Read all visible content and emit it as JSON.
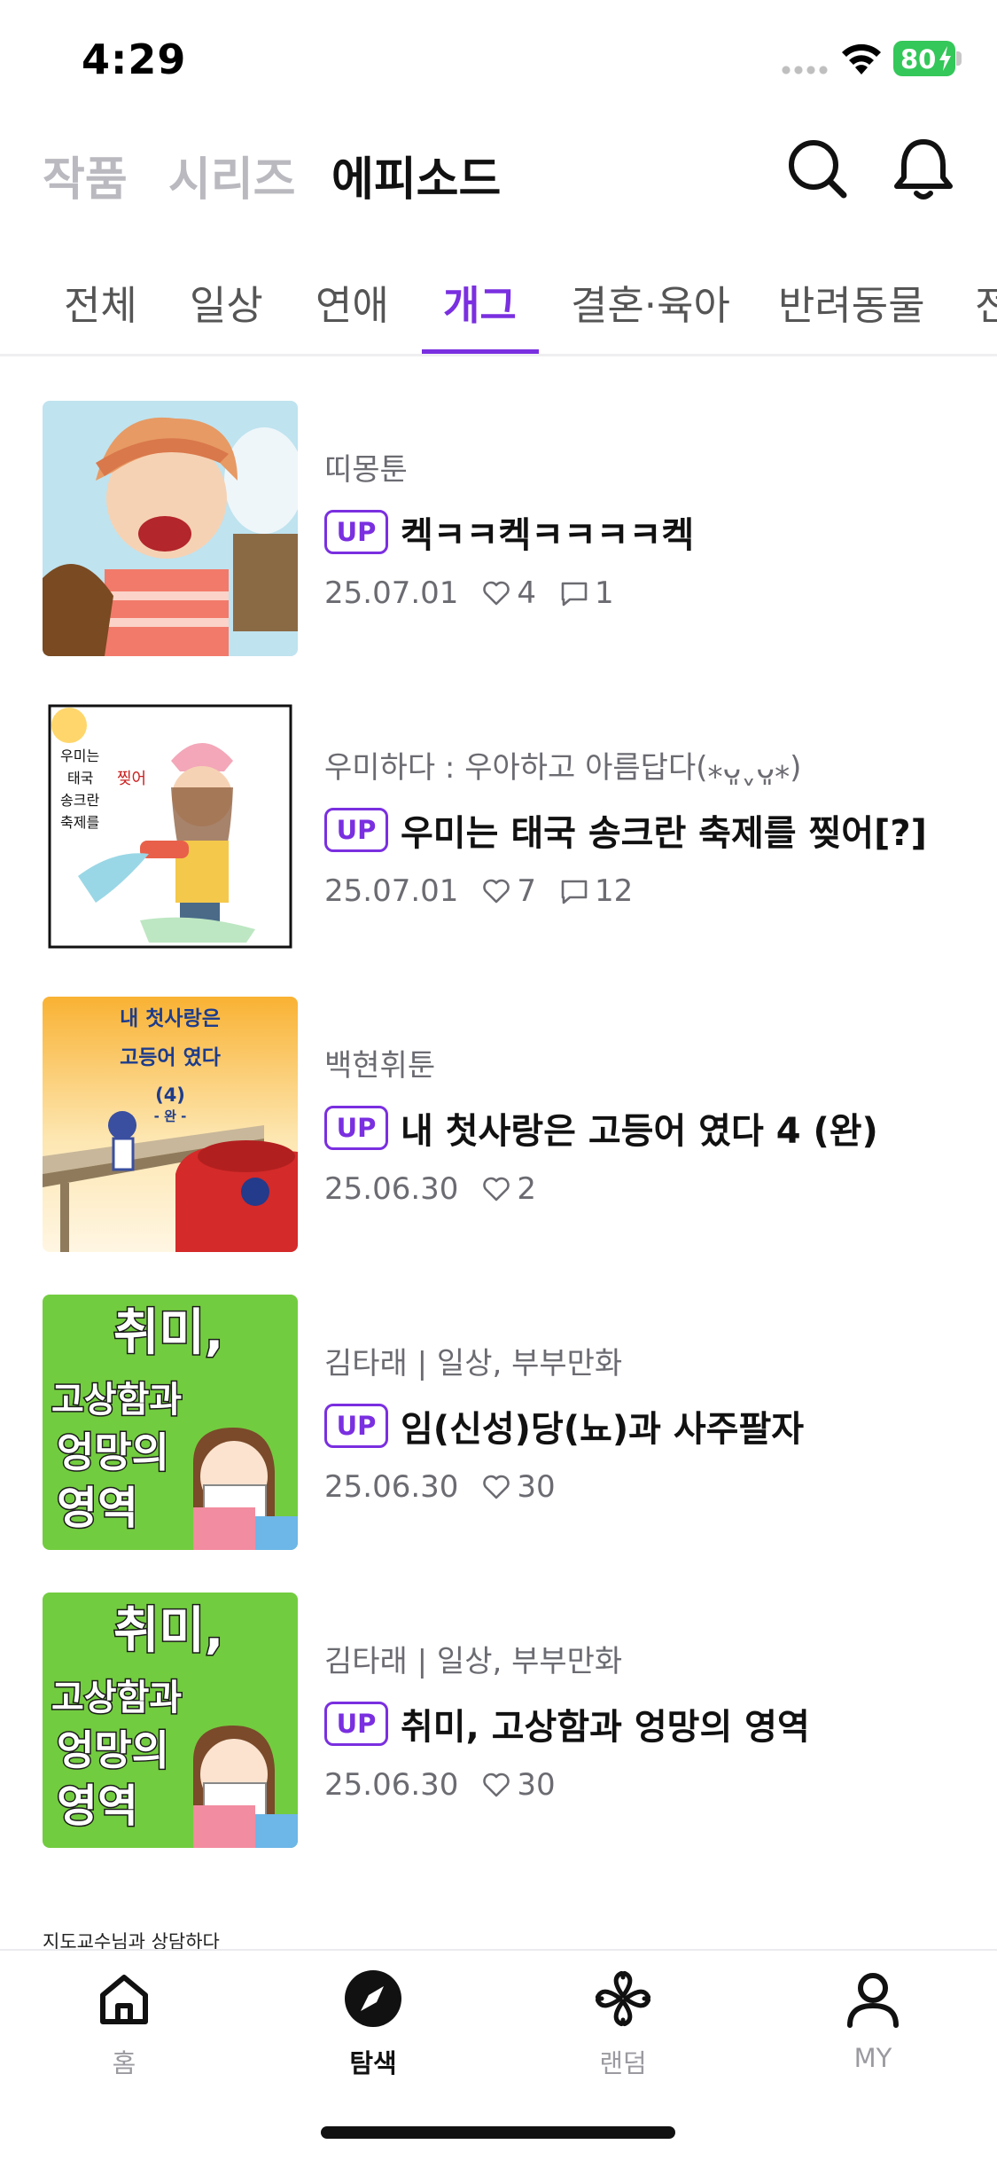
{
  "status": {
    "time": "4:29",
    "battery": "80"
  },
  "top_nav": {
    "tabs": [
      "작품",
      "시리즈",
      "에피소드"
    ],
    "active": 2
  },
  "categories": [
    "전체",
    "일상",
    "연애",
    "개그",
    "결혼·육아",
    "반려동물",
    "전"
  ],
  "active_category": "개그",
  "episodes": [
    {
      "series": "띠몽툰",
      "badge": "UP",
      "title": "켁ㅋㅋ켁ㅋㅋㅋㅋ켁",
      "date": "25.07.01",
      "likes": "4",
      "comments": "1"
    },
    {
      "series": "우미하다 : 우아하고 아름답다(⁎ᴗ͈ˬᴗ͈⁎)",
      "badge": "UP",
      "title": "우미는 태국 송크란 축제를 찢어[?]",
      "date": "25.07.01",
      "likes": "7",
      "comments": "12"
    },
    {
      "series": "백현휘툰",
      "badge": "UP",
      "title": "내 첫사랑은 고등어 였다 4 (완)",
      "date": "25.06.30",
      "likes": "2"
    },
    {
      "series": "김타래 | 일상, 부부만화",
      "badge": "UP",
      "title": "임(신성)당(뇨)과 사주팔자",
      "date": "25.06.30",
      "likes": "30"
    },
    {
      "series": "김타래 | 일상, 부부만화",
      "badge": "UP",
      "title": "취미, 고상함과 엉망의 영역",
      "date": "25.06.30",
      "likes": "30"
    }
  ],
  "thumbnails": {
    "ep3_text": [
      "내 첫사랑은",
      "고등어 였다",
      "(4)",
      "- 완 -"
    ],
    "ep4_text": [
      "취미,",
      "고상함과",
      "엉망의",
      "영역"
    ],
    "ep2_text": [
      "우미는",
      "태국",
      "송크란",
      "축제를",
      "찢어"
    ],
    "peek_text": "지도교수님과 상담하다"
  },
  "tab_bar": {
    "items": [
      "홈",
      "탐색",
      "랜덤",
      "MY"
    ],
    "active": 1
  },
  "colors": {
    "accent": "#7a2fe0",
    "green_thumb": "#72cc3f",
    "battery": "#34c759"
  }
}
